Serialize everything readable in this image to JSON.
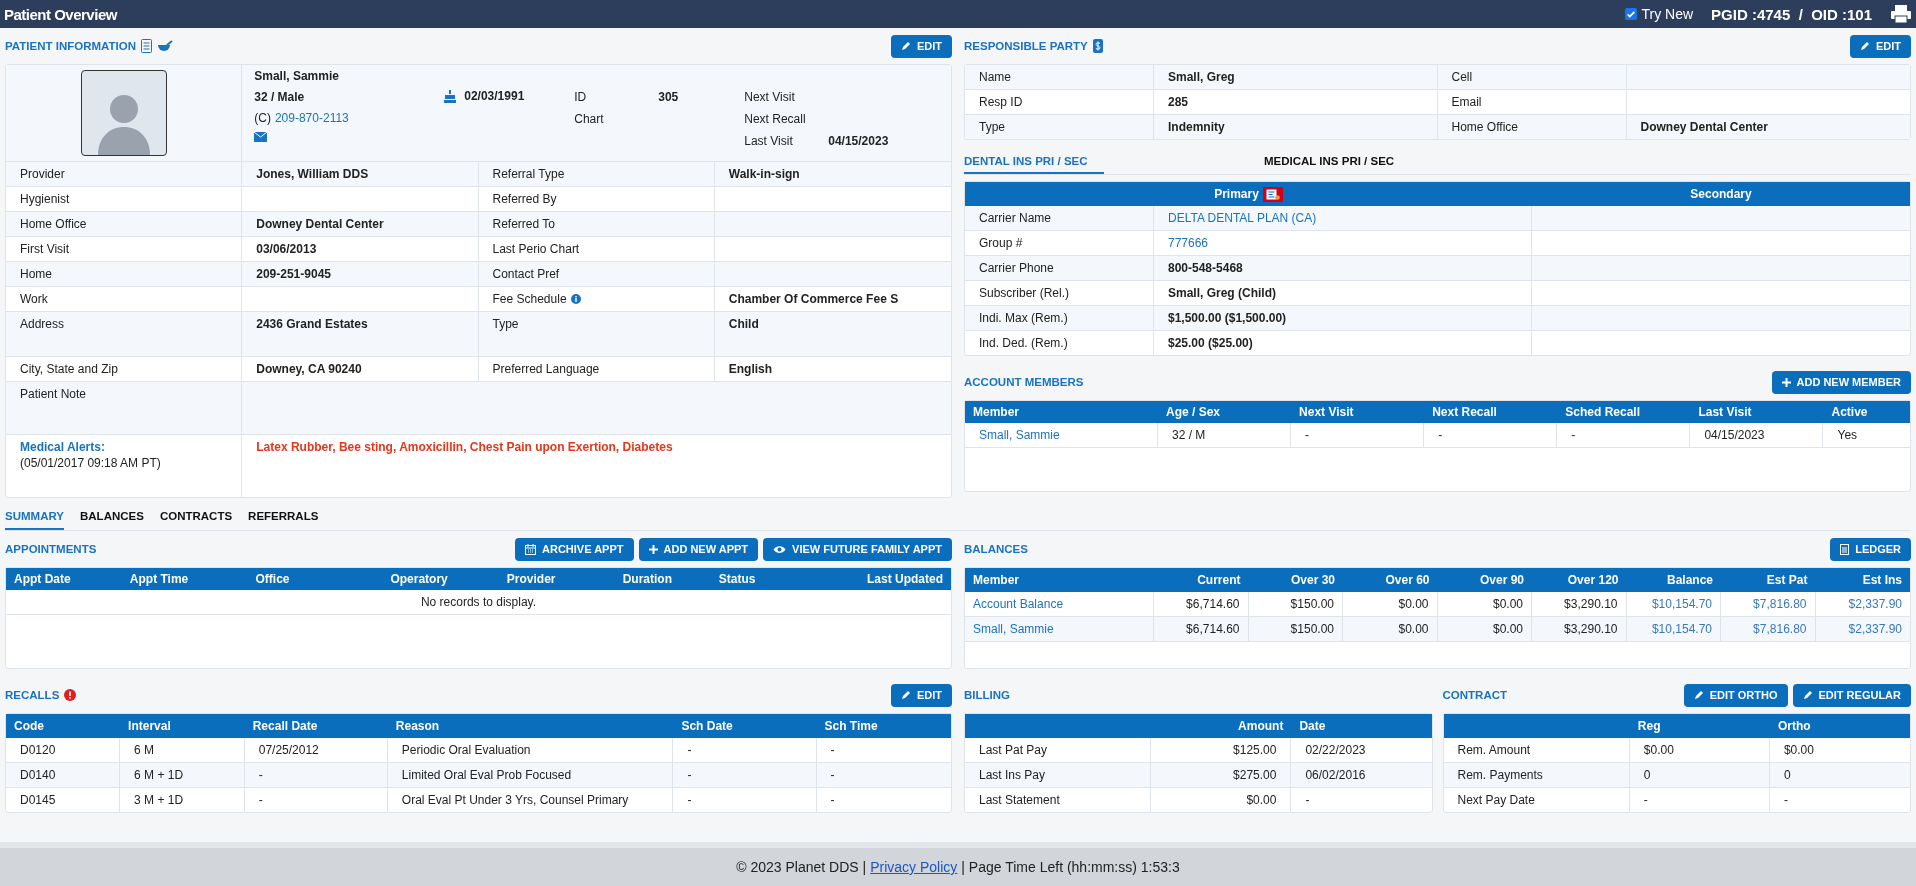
{
  "header": {
    "title": "Patient Overview",
    "try_new": {
      "label": "Try New",
      "checked": true
    },
    "ids": "PGID :4745  /  OID :101"
  },
  "patient_info": {
    "title": "PATIENT INFORMATION",
    "edit_button": "EDIT",
    "name": "Small, Sammie",
    "age_sex": "32 / Male",
    "phone_prefix": "(C)",
    "phone": "209-870-2113",
    "dob": "02/03/1991",
    "id_label": "ID",
    "id_value": "305",
    "chart_label": "Chart",
    "next_visit_label": "Next Visit",
    "next_recall_label": "Next Recall",
    "last_visit_label": "Last Visit",
    "last_visit_value": "04/15/2023",
    "rows": [
      {
        "label": "Provider",
        "value": "Jones, William DDS",
        "label2": "Referral Type",
        "value2": "Walk-in-sign",
        "info": false,
        "tall": false
      },
      {
        "label": "Hygienist",
        "value": "",
        "label2": "Referred By",
        "value2": "",
        "info": false,
        "tall": false
      },
      {
        "label": "Home Office",
        "value": "Downey Dental Center",
        "label2": "Referred To",
        "value2": "",
        "info": false,
        "tall": false
      },
      {
        "label": "First Visit",
        "value": "03/06/2013",
        "label2": "Last Perio Chart",
        "value2": "",
        "info": false,
        "tall": false
      },
      {
        "label": "Home",
        "value": "209-251-9045",
        "label2": "Contact Pref",
        "value2": "",
        "info": false,
        "tall": false
      },
      {
        "label": "Work",
        "value": "",
        "label2": "Fee Schedule",
        "value2": "Chamber Of Commerce Fee S",
        "info": true,
        "tall": false
      },
      {
        "label": "Address",
        "value": "2436 Grand Estates",
        "label2": "Type",
        "value2": "Child",
        "info": false,
        "tall": true
      },
      {
        "label": "City, State and Zip",
        "value": "Downey, CA 90240",
        "label2": "Preferred Language",
        "value2": "English",
        "info": false,
        "tall": false
      }
    ],
    "patient_note_label": "Patient Note",
    "medical_alerts_label": "Medical Alerts:",
    "medical_alerts_date": "(05/01/2017 09:18 AM PT)",
    "medical_alerts": "Latex Rubber, Bee sting, Amoxicillin, Chest Pain upon Exertion, Diabetes"
  },
  "responsible_party": {
    "title": "RESPONSIBLE PARTY",
    "edit_button": "EDIT",
    "rows": [
      {
        "label": "Name",
        "value": "Small, Greg",
        "label2": "Cell",
        "value2": ""
      },
      {
        "label": "Resp ID",
        "value": "285",
        "label2": "Email",
        "value2": ""
      },
      {
        "label": "Type",
        "value": "Indemnity",
        "label2": "Home Office",
        "value2": "Downey Dental Center"
      }
    ]
  },
  "insurance_tabs": [
    {
      "label": "DENTAL INS PRI / SEC",
      "selected": true
    },
    {
      "label": "MEDICAL INS PRI / SEC",
      "selected": false
    }
  ],
  "insurance": {
    "columns": [
      "Primary",
      "Secondary"
    ],
    "rows": [
      {
        "label": "Carrier Name",
        "value": "DELTA DENTAL PLAN (CA)",
        "kind": "link"
      },
      {
        "label": "Group #",
        "value": "777666",
        "kind": "link"
      },
      {
        "label": "Carrier Phone",
        "value": "800-548-5468",
        "kind": "text"
      },
      {
        "label": "Subscriber (Rel.)",
        "value": "Small, Greg (Child)",
        "kind": "text"
      },
      {
        "label": "Indi. Max (Rem.)",
        "value": "$1,500.00 ($1,500.00)",
        "kind": "text"
      },
      {
        "label": "Ind. Ded. (Rem.)",
        "value": "$25.00 ($25.00)",
        "kind": "text"
      }
    ]
  },
  "account_members": {
    "title": "ACCOUNT MEMBERS",
    "add_button": "ADD NEW MEMBER",
    "columns": [
      "Member",
      "Age / Sex",
      "Next Visit",
      "Next Recall",
      "Sched Recall",
      "Last Visit",
      "Active"
    ],
    "rows": [
      [
        "Small, Sammie",
        "32 / M",
        "-",
        "-",
        "-",
        "04/15/2023",
        "Yes"
      ]
    ]
  },
  "page_tabs": [
    {
      "label": "SUMMARY",
      "selected": true
    },
    {
      "label": "BALANCES",
      "selected": false
    },
    {
      "label": "CONTRACTS",
      "selected": false
    },
    {
      "label": "REFERRALS",
      "selected": false
    }
  ],
  "appointments": {
    "title": "APPOINTMENTS",
    "buttons": [
      "ARCHIVE APPT",
      "ADD NEW APPT",
      "VIEW FUTURE FAMILY APPT"
    ],
    "columns": [
      "Appt Date",
      "Appt Time",
      "Office",
      "Operatory",
      "Provider",
      "Duration",
      "Status",
      "Last Updated"
    ],
    "empty_message": "No records to display."
  },
  "recalls": {
    "title": "RECALLS",
    "alert": true,
    "edit_button": "EDIT",
    "columns": [
      "Code",
      "Interval",
      "Recall Date",
      "Reason",
      "Sch Date",
      "Sch Time"
    ],
    "rows": [
      [
        "D0120",
        "6 M",
        "07/25/2012",
        "Periodic Oral Evaluation",
        "-",
        "-"
      ],
      [
        "D0140",
        "6 M + 1D",
        "-",
        "Limited Oral Eval Prob Focused",
        "-",
        "-"
      ],
      [
        "D0145",
        "3 M + 1D",
        "-",
        "Oral Eval Pt Under 3 Yrs, Counsel Primary",
        "-",
        "-"
      ]
    ]
  },
  "balances": {
    "title": "BALANCES",
    "ledger_button": "LEDGER",
    "columns": [
      "Member",
      "Current",
      "Over 30",
      "Over 60",
      "Over 90",
      "Over 120",
      "Balance",
      "Est Pat",
      "Est Ins"
    ],
    "rows": [
      [
        "Account Balance",
        "$6,714.60",
        "$150.00",
        "$0.00",
        "$0.00",
        "$3,290.10",
        "$10,154.70",
        "$7,816.80",
        "$2,337.90"
      ],
      [
        "Small, Sammie",
        "$6,714.60",
        "$150.00",
        "$0.00",
        "$0.00",
        "$3,290.10",
        "$10,154.70",
        "$7,816.80",
        "$2,337.90"
      ]
    ]
  },
  "billing": {
    "title": "BILLING",
    "columns": [
      "",
      "Amount",
      "Date"
    ],
    "rows": [
      [
        "Last Pat Pay",
        "$125.00",
        "02/22/2023"
      ],
      [
        "Last Ins Pay",
        "$275.00",
        "06/02/2016"
      ],
      [
        "Last Statement",
        "$0.00",
        "-"
      ]
    ]
  },
  "contract": {
    "title": "CONTRACT",
    "buttons": [
      "EDIT ORTHO",
      "EDIT REGULAR"
    ],
    "columns": [
      "",
      "Reg",
      "Ortho"
    ],
    "rows": [
      [
        "Rem. Amount",
        "$0.00",
        "$0.00"
      ],
      [
        "Rem. Payments",
        "0",
        "0"
      ],
      [
        "Next Pay Date",
        "-",
        "-"
      ]
    ]
  },
  "footer": {
    "copyright": "© 2023 Planet DDS |",
    "link": "Privacy Policy",
    "time_left": "| Page Time Left (hh:mm:ss) 1:53:3"
  }
}
